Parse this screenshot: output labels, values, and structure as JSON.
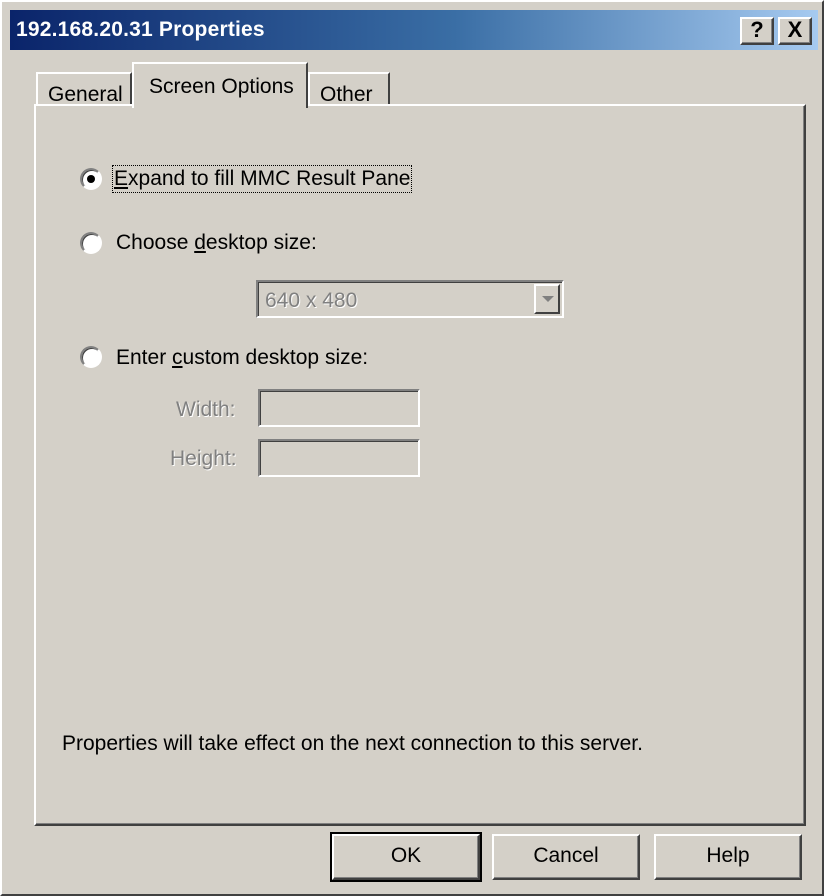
{
  "window": {
    "title": "192.168.20.31 Properties",
    "help_glyph": "?",
    "close_glyph": "X"
  },
  "tabs": [
    {
      "label": "General",
      "selected": false
    },
    {
      "label": "Screen Options",
      "selected": true
    },
    {
      "label": "Other",
      "selected": false
    }
  ],
  "options": {
    "expand": {
      "label_mnemonic": "E",
      "label_rest": "xpand to fill MMC Result Pane",
      "selected": true
    },
    "choose": {
      "label_before": "Choose ",
      "label_mnemonic": "d",
      "label_after": "esktop size:",
      "selected": false
    },
    "custom": {
      "label_before": "Enter ",
      "label_mnemonic": "c",
      "label_after": "ustom desktop size:",
      "selected": false
    }
  },
  "desktop_size": {
    "value": "640 x 480"
  },
  "custom_size": {
    "width_label": "Width:",
    "height_label": "Height:",
    "width_value": "",
    "height_value": ""
  },
  "note": "Properties will take effect on the next connection to this server.",
  "buttons": {
    "ok": "OK",
    "cancel": "Cancel",
    "help": "Help"
  }
}
